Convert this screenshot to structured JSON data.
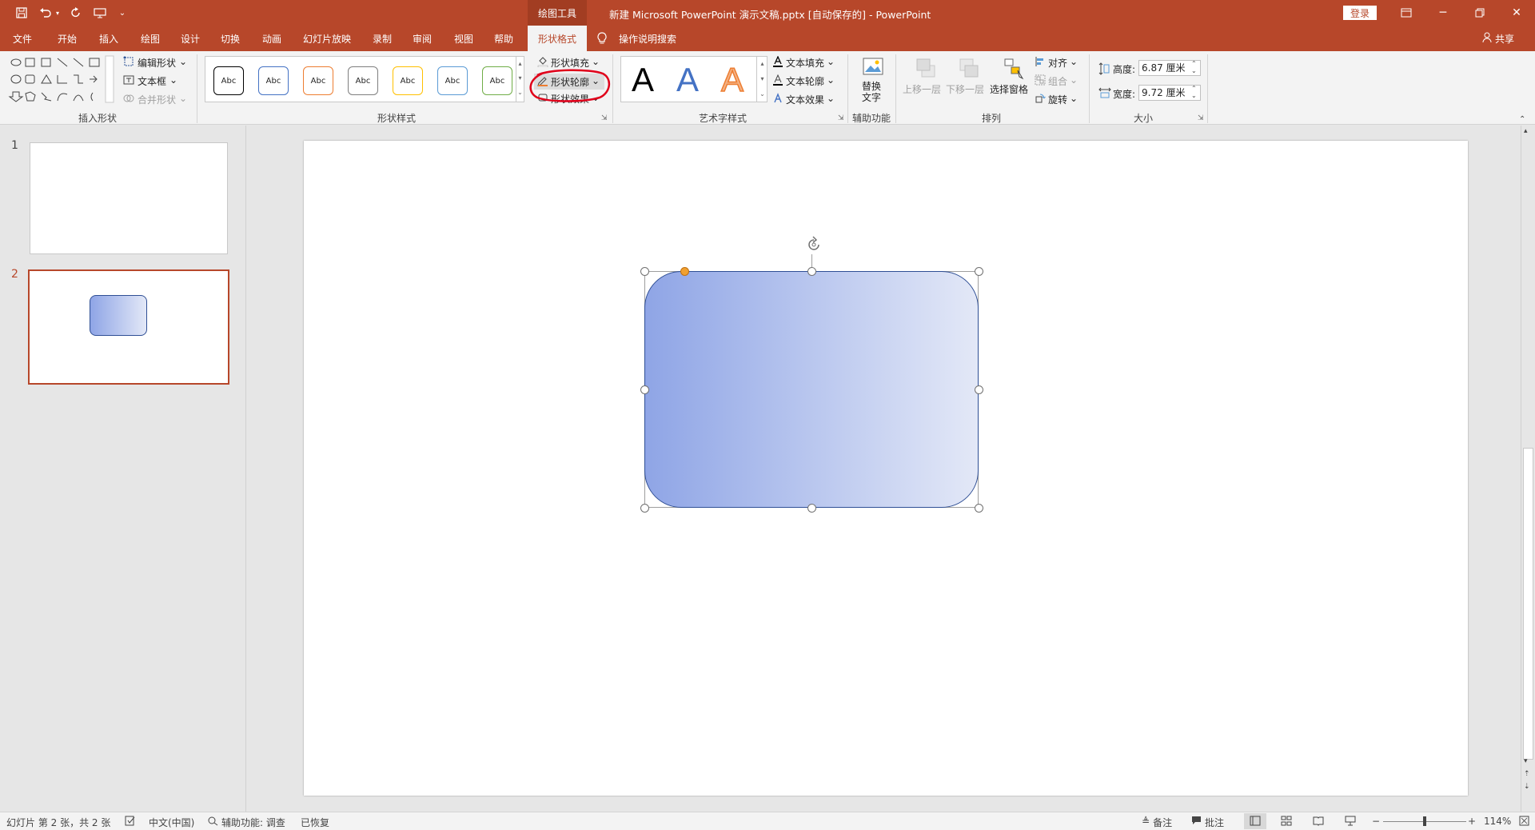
{
  "window": {
    "title": "新建 Microsoft PowerPoint 演示文稿.pptx [自动保存的] - PowerPoint",
    "context_tools": "绘图工具",
    "login": "登录",
    "share": "共享"
  },
  "tabs": [
    "文件",
    "开始",
    "插入",
    "绘图",
    "设计",
    "切换",
    "动画",
    "幻灯片放映",
    "录制",
    "审阅",
    "视图",
    "帮助",
    "形状格式"
  ],
  "active_tab": "形状格式",
  "tell_me": "操作说明搜索",
  "ribbon": {
    "insert_shapes": {
      "label": "插入形状",
      "edit_shape": "编辑形状",
      "text_box": "文本框",
      "merge_shapes": "合并形状"
    },
    "shape_styles": {
      "label": "形状样式",
      "sample": "Abc",
      "style_colors": [
        "#000000",
        "#4472c4",
        "#ed7d31",
        "#7f7f7f",
        "#ffc000",
        "#5b9bd5",
        "#70ad47"
      ],
      "fill": "形状填充",
      "outline": "形状轮廓",
      "effects": "形状效果"
    },
    "wordart": {
      "label": "艺术字样式",
      "sample": "A",
      "text_fill": "文本填充",
      "text_outline": "文本轮廓",
      "text_effects": "文本效果"
    },
    "accessibility": {
      "label": "辅助功能",
      "alt_text_line1": "替换",
      "alt_text_line2": "文字"
    },
    "arrange": {
      "label": "排列",
      "bring_forward": "上移一层",
      "send_backward": "下移一层",
      "selection_pane": "选择窗格",
      "align": "对齐",
      "group": "组合",
      "rotate": "旋转"
    },
    "size": {
      "label": "大小",
      "height_label": "高度:",
      "height_value": "6.87 厘米",
      "width_label": "宽度:",
      "width_value": "9.72 厘米"
    }
  },
  "slides": [
    {
      "number": "1"
    },
    {
      "number": "2"
    }
  ],
  "shape": {
    "gradient_start": "#8fa5e6",
    "gradient_end": "#e3e8f7",
    "border": "#2f4f95"
  },
  "status": {
    "slide_info": "幻灯片 第 2 张，共 2 张",
    "language": "中文(中国)",
    "accessibility": "辅助功能: 调查",
    "recovered": "已恢复",
    "notes": "备注",
    "comments": "批注",
    "zoom": "114%"
  },
  "colors": {
    "accent": "#b7472a",
    "annotation": "#e0001a"
  }
}
